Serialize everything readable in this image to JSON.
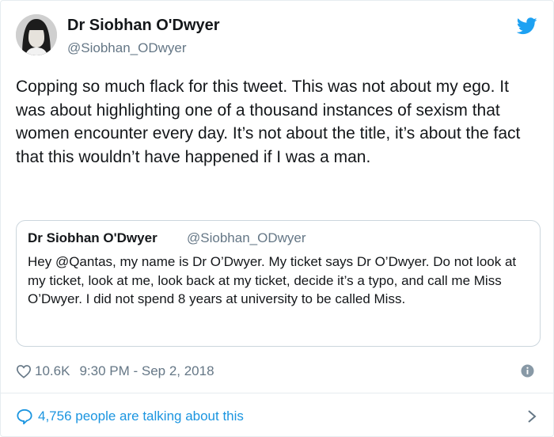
{
  "author": {
    "name": "Dr Siobhan O'Dwyer",
    "handle": "@Siobhan_ODwyer"
  },
  "tweet": {
    "text": "Copping so much flack for this tweet. This was not about my ego. It was about highlighting one of a thousand instances of sexism that women encounter every day. It’s not about the title, it’s about the fact that this wouldn’t have happened if I was a man."
  },
  "quoted_tweet": {
    "name": "Dr Siobhan O'Dwyer",
    "handle": "@Siobhan_ODwyer",
    "text": "Hey @Qantas, my name is Dr O’Dwyer. My ticket says Dr O’Dwyer. Do not look at my ticket, look at me, look back at my ticket, decide it’s a typo, and call me Miss O’Dwyer. I did not spend 8 years at university to be called Miss."
  },
  "meta": {
    "likes": "10.6K",
    "timestamp": "9:30 PM - Sep 2, 2018"
  },
  "footer": {
    "talking": "4,756 people are talking about this"
  },
  "icons": {
    "logo": "twitter-bird-icon",
    "like": "heart-icon",
    "info": "info-icon",
    "talking": "speech-bubble-icon",
    "more": "chevron-right-icon"
  },
  "colors": {
    "brand": "#1da1f2",
    "link": "#1b95e0",
    "muted": "#657786",
    "text": "#14171a"
  }
}
